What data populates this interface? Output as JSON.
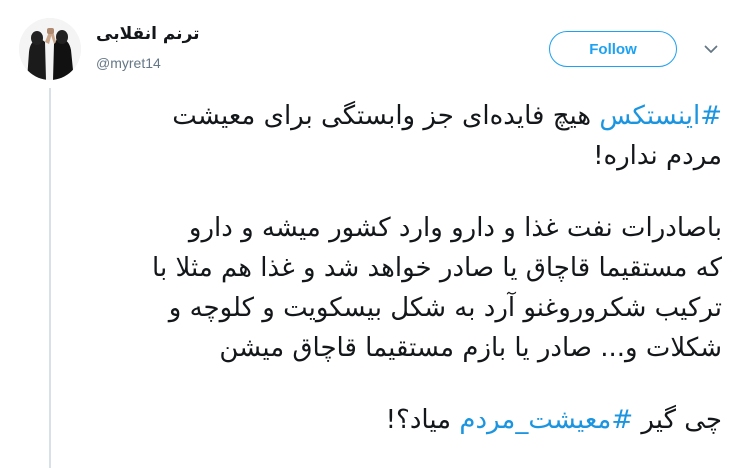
{
  "user": {
    "display_name": "ترنم انقلابی",
    "handle": "@myret14"
  },
  "follow_button": {
    "label": "Follow"
  },
  "icons": {
    "menu": "chevron-down-icon"
  },
  "colors": {
    "accent": "#1da1f2",
    "hashtag": "#1b95e0",
    "text": "#14171a",
    "secondary_text": "#657786",
    "thread_line": "#d9e1e8"
  },
  "tweet": {
    "line1": {
      "hashtag": "#اینستکس",
      "text": " هیچ فایده‌ای جز وابستگی برای معیشت"
    },
    "line2": "مردم نداره!",
    "paragraph2": [
      "باصادرات نفت غذا و دارو وارد کشور میشه و دارو",
      "که مستقیما قاچاق یا صادر خواهد شد و غذا هم مثلا با",
      "ترکیب شکروروغنو آرد به شکل بیسکویت و کلوچه و",
      "شکلات و... صادر یا بازم مستقیما قاچاق میشن"
    ],
    "last_line": {
      "before": "چی گیر ",
      "hashtag": "#معیشت_مردم",
      "after": " میاد؟!"
    }
  }
}
